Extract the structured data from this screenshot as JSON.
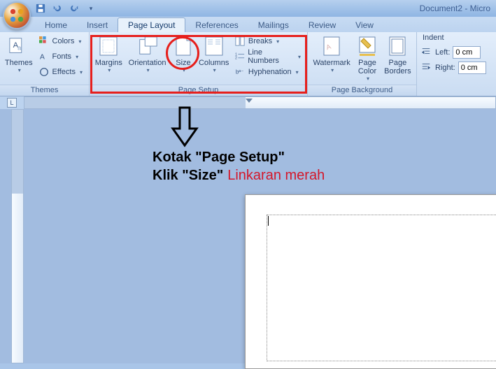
{
  "title": "Document2 - Micro",
  "tabs": [
    "Home",
    "Insert",
    "Page Layout",
    "References",
    "Mailings",
    "Review",
    "View"
  ],
  "active_tab": 2,
  "groups": {
    "themes": {
      "label": "Themes",
      "themes_btn": "Themes",
      "colors": "Colors",
      "fonts": "Fonts",
      "effects": "Effects"
    },
    "pagesetup": {
      "label": "Page Setup",
      "margins": "Margins",
      "orientation": "Orientation",
      "size": "Size",
      "columns": "Columns",
      "breaks": "Breaks",
      "linenumbers": "Line Numbers",
      "hyphenation": "Hyphenation"
    },
    "pagebg": {
      "label": "Page Background",
      "watermark": "Watermark",
      "pagecolor": "Page\nColor",
      "pageborders": "Page\nBorders"
    },
    "para": {
      "label": "Indent",
      "left": "Left:",
      "right": "Right:",
      "leftval": "0 cm",
      "rightval": "0 cm"
    }
  },
  "annotation": {
    "line1": "Kotak \"Page Setup\"",
    "line2a": "Klik \"Size\"",
    "line2b": "Linkaran merah"
  },
  "ruler_selector": "L"
}
